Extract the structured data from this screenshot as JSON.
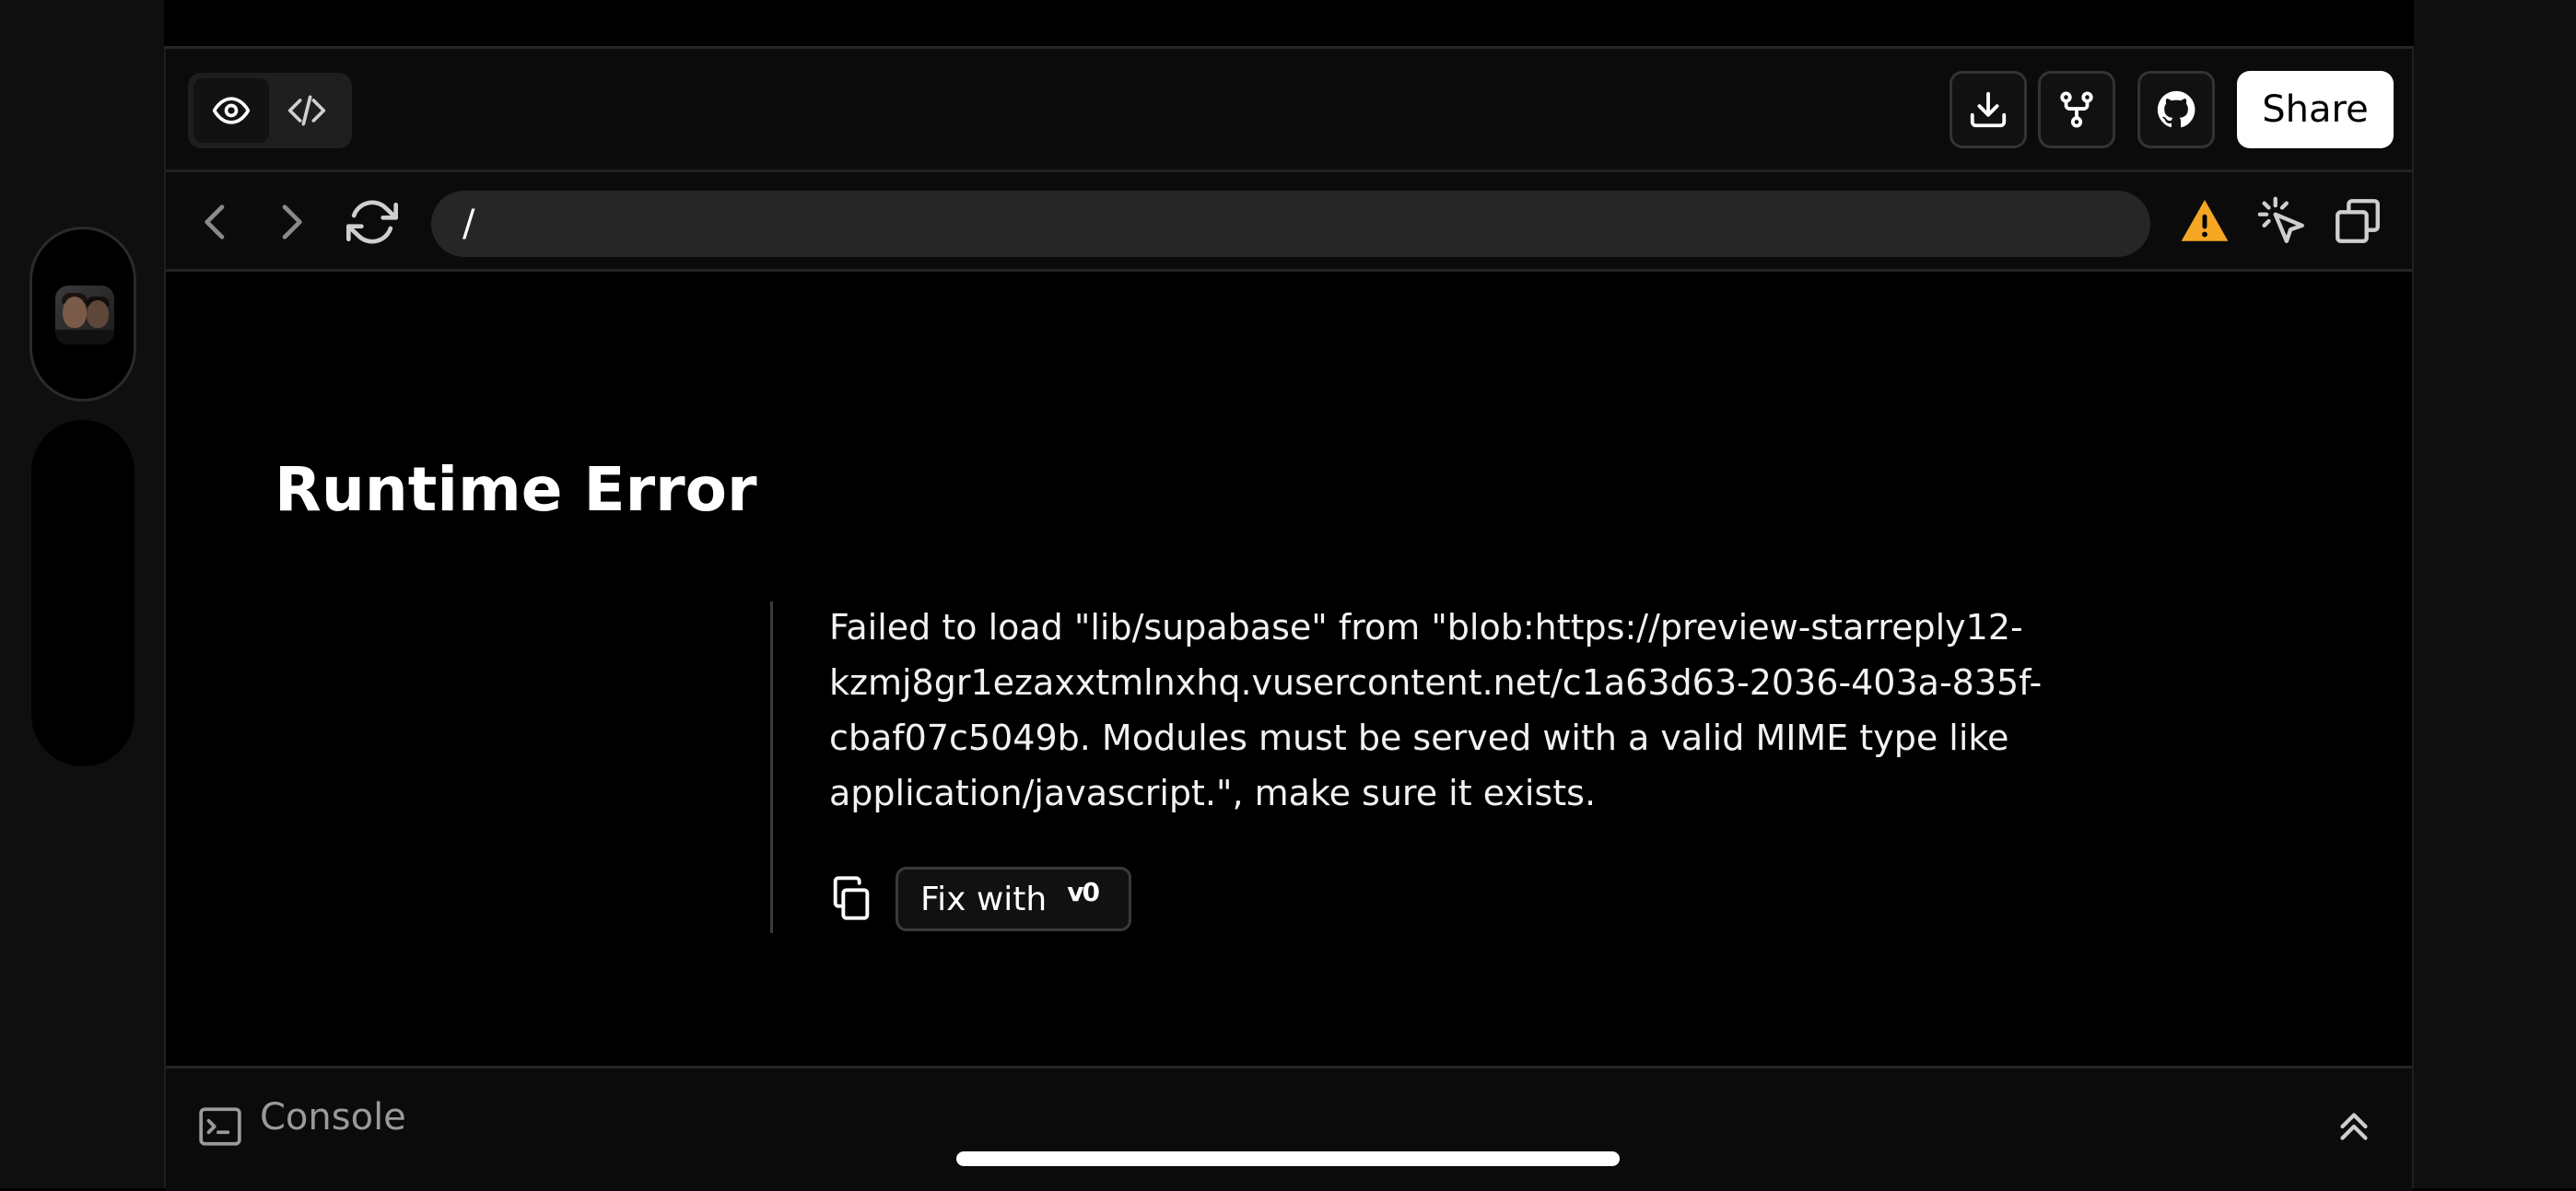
{
  "toolbar": {
    "preview_icon": "eye-icon",
    "code_icon": "code-icon",
    "download_icon": "download-icon",
    "fork_icon": "fork-icon",
    "github_icon": "github-icon",
    "share_label": "Share"
  },
  "address_bar": {
    "back_icon": "chevron-left-icon",
    "forward_icon": "chevron-right-icon",
    "refresh_icon": "refresh-icon",
    "url": "/",
    "warning_icon": "warning-icon",
    "select_icon": "cursor-select-icon",
    "open_icon": "copy-window-icon",
    "warning_color": "#f5a623"
  },
  "error": {
    "title": "Runtime Error",
    "message": "Failed to load \"lib/supabase\" from \"blob:https://preview-starreply12-kzmj8gr1ezaxxtmlnxhq.vusercontent.net/c1a63d63-2036-403a-835f-cbaf07c5049b. Modules must be served with a valid MIME type like application/javascript.\", make sure it exists.",
    "fix_label": "Fix with",
    "fix_brand": "v0"
  },
  "console": {
    "label": "Console"
  }
}
